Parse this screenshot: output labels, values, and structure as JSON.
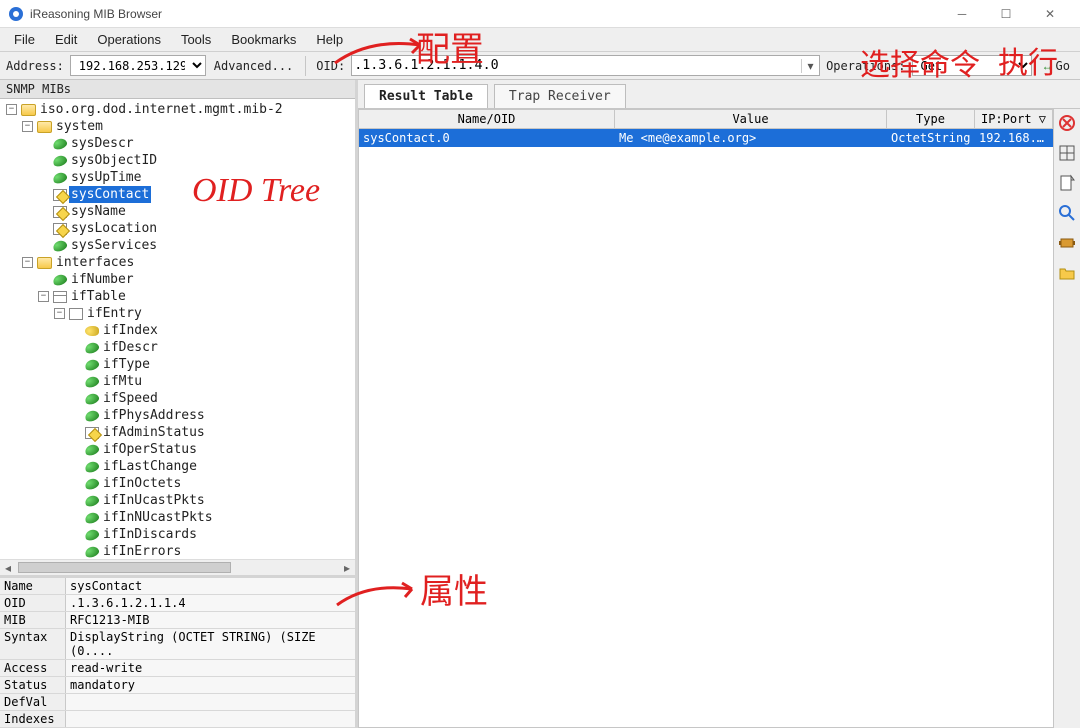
{
  "titlebar": {
    "title": "iReasoning MIB Browser"
  },
  "menus": [
    "File",
    "Edit",
    "Operations",
    "Tools",
    "Bookmarks",
    "Help"
  ],
  "toolbar": {
    "address_label": "Address:",
    "address_value": "192.168.253.129",
    "advanced_label": "Advanced...",
    "oid_label": "OID:",
    "oid_value": ".1.3.6.1.2.1.1.4.0",
    "operations_label": "Operations:",
    "operations_value": "Get",
    "go_label": "Go"
  },
  "left_panel_title": "SNMP MIBs",
  "tree": {
    "root": "iso.org.dod.internet.mgmt.mib-2",
    "system": {
      "label": "system",
      "children": [
        "sysDescr",
        "sysObjectID",
        "sysUpTime",
        "sysContact",
        "sysName",
        "sysLocation",
        "sysServices"
      ],
      "selected": "sysContact"
    },
    "interfaces": {
      "label": "interfaces",
      "ifNumber": "ifNumber",
      "ifTable": "ifTable",
      "ifEntry": "ifEntry",
      "entry_children": [
        "ifIndex",
        "ifDescr",
        "ifType",
        "ifMtu",
        "ifSpeed",
        "ifPhysAddress",
        "ifAdminStatus",
        "ifOperStatus",
        "ifLastChange",
        "ifInOctets",
        "ifInUcastPkts",
        "ifInNUcastPkts",
        "ifInDiscards",
        "ifInErrors"
      ]
    }
  },
  "details": {
    "Name": "sysContact",
    "OID": ".1.3.6.1.2.1.1.4",
    "MIB": "RFC1213-MIB",
    "Syntax": "DisplayString (OCTET STRING) (SIZE (0....",
    "Access": "read-write",
    "Status": "mandatory",
    "DefVal": "",
    "Indexes": ""
  },
  "detail_keys": [
    "Name",
    "OID",
    "MIB",
    "Syntax",
    "Access",
    "Status",
    "DefVal",
    "Indexes"
  ],
  "tabs": {
    "result": "Result Table",
    "trap": "Trap Receiver"
  },
  "result_headers": {
    "name": "Name/OID",
    "value": "Value",
    "type": "Type",
    "ipport": "IP:Port"
  },
  "result_rows": [
    {
      "name": "sysContact.0",
      "value": "Me <me@example.org>",
      "type": "OctetString",
      "ipport": "192.168.2..."
    }
  ],
  "side_tools": [
    "delete",
    "grid",
    "new",
    "search",
    "component",
    "open"
  ],
  "annotations": {
    "config": "配置",
    "oid_tree": "OID Tree",
    "select_op": "选择命令",
    "execute": "执行",
    "attrs": "属性"
  }
}
